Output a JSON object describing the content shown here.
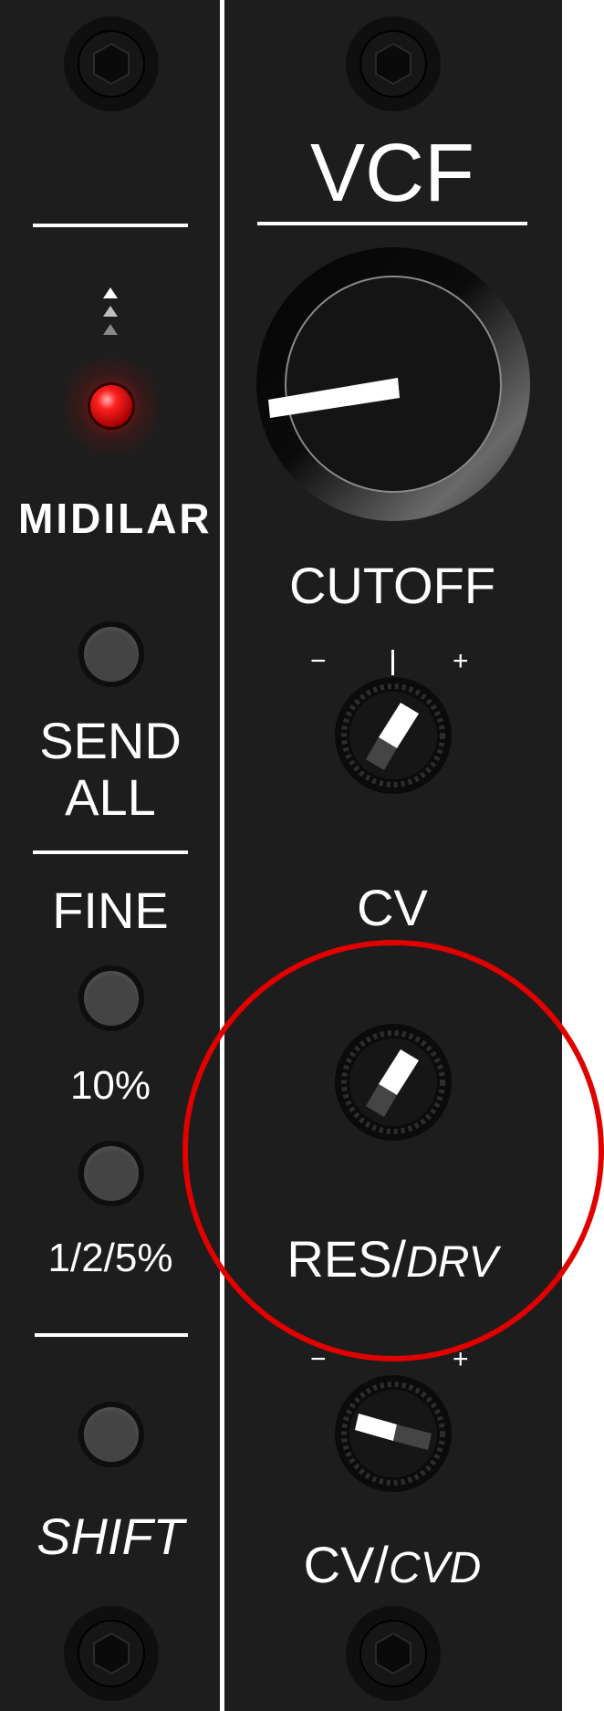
{
  "left": {
    "logo": "MIDILAR",
    "send_all_label_line1": "SEND",
    "send_all_label_line2": "ALL",
    "fine_label": "FINE",
    "ten_percent_label": "10%",
    "step_label": "1/2/5%",
    "shift_label": "SHIFT",
    "led_color": "#ff1010"
  },
  "right": {
    "title": "VCF",
    "cutoff_label": "CUTOFF",
    "cv_label": "CV",
    "res_label": "RES/",
    "res_label_italic": "DRV",
    "cvcvd_label": "CV/",
    "cvcvd_label_italic": "CVD",
    "minus": "−",
    "plus": "+"
  },
  "colors": {
    "panel": "#1d1d1d",
    "text": "#ffffff",
    "highlight_ring": "#e00000"
  }
}
